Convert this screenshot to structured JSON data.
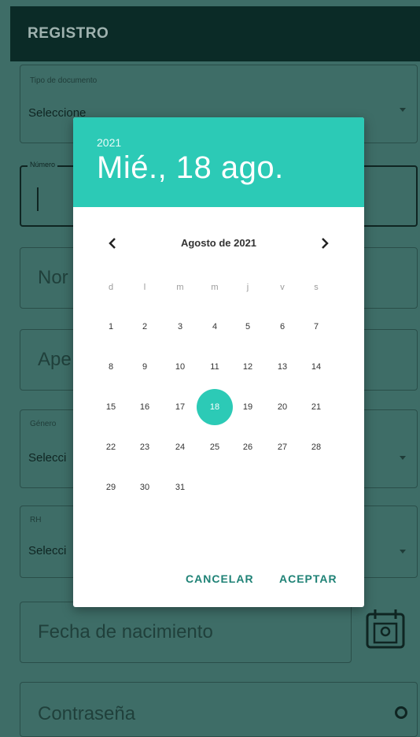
{
  "appbar": {
    "title": "REGISTRO"
  },
  "form": {
    "tipo_documento": {
      "label": "Tipo de documento",
      "value": "Seleccione"
    },
    "numero": {
      "label": "Número"
    },
    "nombres": {
      "placeholder": "Nor"
    },
    "apellidos": {
      "placeholder": "Ape"
    },
    "genero": {
      "label": "Género",
      "value": "Selecci"
    },
    "rh": {
      "label": "RH",
      "value": "Selecci"
    },
    "fecha": {
      "placeholder": "Fecha de nacimiento"
    },
    "contrasena": {
      "placeholder": "Contraseña"
    }
  },
  "dialog": {
    "year": "2021",
    "date": "Mié., 18 ago.",
    "month_label": "Agosto de 2021",
    "weekdays": [
      "d",
      "l",
      "m",
      "m",
      "j",
      "v",
      "s"
    ],
    "days": [
      "1",
      "2",
      "3",
      "4",
      "5",
      "6",
      "7",
      "8",
      "9",
      "10",
      "11",
      "12",
      "13",
      "14",
      "15",
      "16",
      "17",
      "18",
      "19",
      "20",
      "21",
      "22",
      "23",
      "24",
      "25",
      "26",
      "27",
      "28",
      "29",
      "30",
      "31"
    ],
    "selected_day": "18",
    "cancel_label": "CANCELAR",
    "accept_label": "ACEPTAR"
  },
  "colors": {
    "accent": "#2ccab6",
    "appbar": "#0b2b27",
    "scrim": "#3e6d67"
  }
}
